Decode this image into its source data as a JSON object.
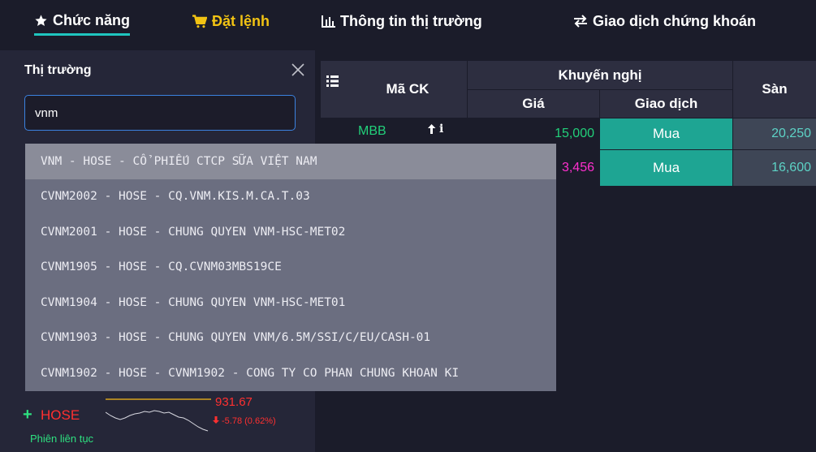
{
  "tabs": [
    {
      "label": "Chức năng",
      "icon": "star-icon"
    },
    {
      "label": "Đặt lệnh",
      "icon": "cart-icon"
    },
    {
      "label": "Thông tin thị trường",
      "icon": "bar-chart-icon"
    },
    {
      "label": "Giao dịch chứng khoán",
      "icon": "swap-arrows-icon"
    }
  ],
  "search_panel": {
    "title": "Thị trường",
    "query": "vnm"
  },
  "table": {
    "col_symbol": "Mã CK",
    "col_recommend": "Khuyến nghị",
    "col_price": "Giá",
    "col_trade": "Giao dịch",
    "col_floor": "Sàn",
    "rows": [
      {
        "symbol": "MBB",
        "price": "15,000",
        "action": "Mua",
        "floor": "20,250"
      },
      {
        "symbol": "",
        "price": "3,456",
        "action": "Mua",
        "floor": "16,600"
      }
    ]
  },
  "suggestions": [
    "VNM - HOSE - CỔ PHIẾU CTCP SỮA VIỆT NAM",
    "CVNM2002 - HOSE - CQ.VNM.KIS.M.CA.T.03",
    "CVNM2001 - HOSE - CHUNG QUYEN VNM-HSC-MET02",
    "CVNM1905 - HOSE - CQ.CVNM03MBS19CE",
    "CVNM1904 - HOSE - CHUNG QUYEN VNM-HSC-MET01",
    "CVNM1903 - HOSE - CHUNG QUYEN VNM/6.5M/SSI/C/EU/CASH-01",
    "CVNM1902 - HOSE - CVNM1902 - CONG TY CO PHAN CHUNG KHOAN KI"
  ],
  "market": {
    "plus": "+",
    "name": "HOSE",
    "session": "Phiên liên tục",
    "value": "931.67",
    "change": "-5.78 (0.62%)"
  },
  "colors": {
    "accent": "#1fc6bf",
    "order_tab": "#f2c313",
    "buy": "#1ea593",
    "down": "#ff3030",
    "up": "#22d07a"
  }
}
